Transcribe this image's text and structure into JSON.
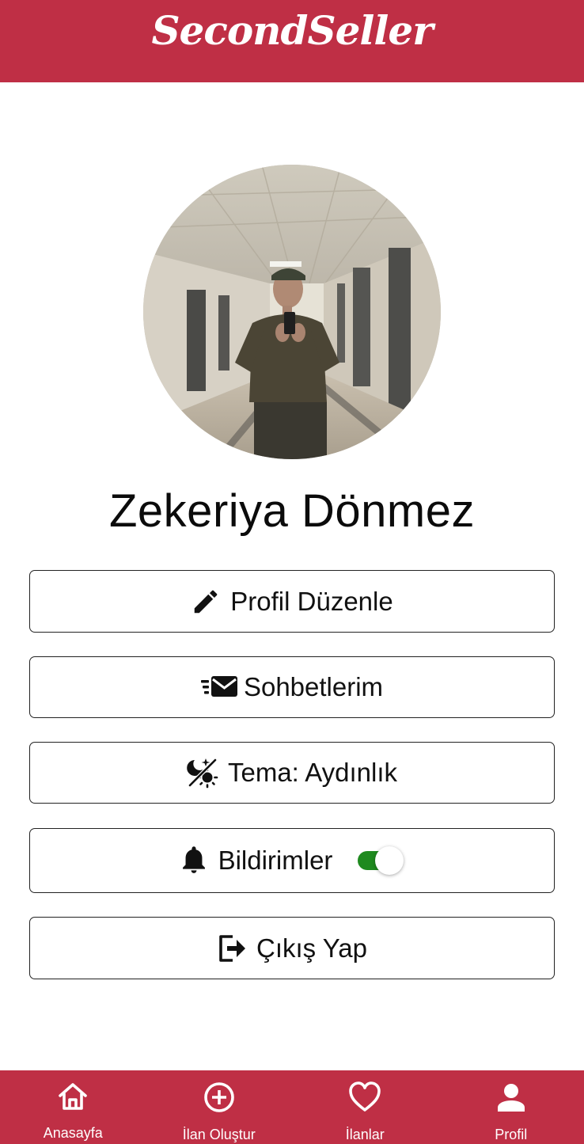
{
  "app": {
    "title": "SecondSeller",
    "brand_color": "#bf2f45"
  },
  "profile": {
    "name": "Zekeriya Dönmez",
    "avatar_icon": "profile-photo"
  },
  "menu": {
    "edit_profile": {
      "label": "Profil Düzenle",
      "icon": "pencil-icon"
    },
    "chats": {
      "label": "Sohbetlerim",
      "icon": "fast-mail-icon"
    },
    "theme": {
      "label": "Tema: Aydınlık",
      "icon": "theme-night-day-icon"
    },
    "notifications": {
      "label": "Bildirimler",
      "icon": "bell-icon",
      "enabled": true,
      "toggle_color": "#1f8a1f"
    },
    "logout": {
      "label": "Çıkış Yap",
      "icon": "logout-icon"
    }
  },
  "bottom_nav": {
    "items": [
      {
        "label": "Anasayfa",
        "icon": "home-icon"
      },
      {
        "label": "İlan Oluştur",
        "icon": "add-circle-icon"
      },
      {
        "label": "İlanlar",
        "icon": "heart-icon"
      },
      {
        "label": "Profil",
        "icon": "person-icon"
      }
    ],
    "active": "Profil"
  }
}
